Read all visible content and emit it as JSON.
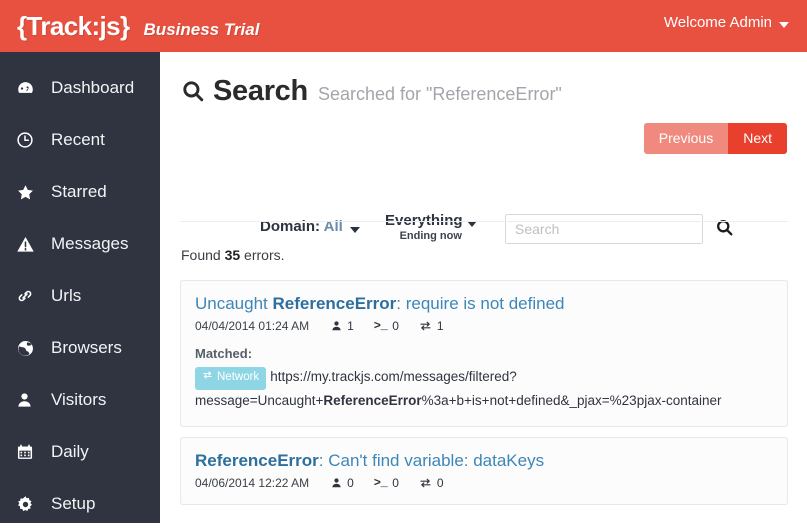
{
  "header": {
    "logo": "{Track:js}",
    "plan": "Business Trial",
    "welcome": "Welcome Admin",
    "brand_color": "#e8503f",
    "caret_icon": "chevron-down-icon"
  },
  "sidebar": {
    "background": "#2f3440",
    "items": [
      {
        "label": "Dashboard",
        "icon": "dashboard-icon"
      },
      {
        "label": "Recent",
        "icon": "clock-icon"
      },
      {
        "label": "Starred",
        "icon": "star-icon"
      },
      {
        "label": "Messages",
        "icon": "warning-triangle-icon"
      },
      {
        "label": "Urls",
        "icon": "link-icon"
      },
      {
        "label": "Browsers",
        "icon": "globe-icon"
      },
      {
        "label": "Visitors",
        "icon": "user-icon"
      },
      {
        "label": "Daily",
        "icon": "calendar-icon"
      },
      {
        "label": "Setup",
        "icon": "gear-icon"
      }
    ]
  },
  "page": {
    "title": "Search",
    "title_icon": "search-icon",
    "subtitle": "Searched for \"ReferenceError\"",
    "found_prefix": "Found ",
    "found_count": "35",
    "found_suffix": " errors."
  },
  "pager": {
    "previous_label": "Previous",
    "next_label": "Next",
    "previous_color": "#f08a7e",
    "next_color": "#e8402c"
  },
  "filters": {
    "domain_label": "Domain:",
    "domain_value": "All",
    "range_label": "Everything",
    "range_sub": "Ending now"
  },
  "search": {
    "placeholder": "Search",
    "value": "",
    "submit_icon": "search-icon"
  },
  "results": [
    {
      "title_prefix": "Uncaught ",
      "title_error": "ReferenceError",
      "title_suffix": ": require is not defined",
      "date": "04/04/2014 01:24 AM",
      "visitors": "1",
      "console": "0",
      "network": "1",
      "matched_label": "Matched:",
      "matched_badge": "Network",
      "matched_badge_color": "#8fd6e4",
      "matched_url_1": "https://my.trackjs.com/messages/filtered?message=Uncaught+",
      "matched_url_bold": "ReferenceError",
      "matched_url_2": "%3a+b+is+not+defined&_pjax=%23pjax-container"
    },
    {
      "title_prefix": "",
      "title_error": "ReferenceError",
      "title_suffix": ": Can't find variable: dataKeys",
      "date": "04/06/2014 12:22 AM",
      "visitors": "0",
      "console": "0",
      "network": "0"
    }
  ],
  "icons": {
    "visitors": "user-icon",
    "console": "console-icon",
    "network": "network-exchange-icon"
  }
}
